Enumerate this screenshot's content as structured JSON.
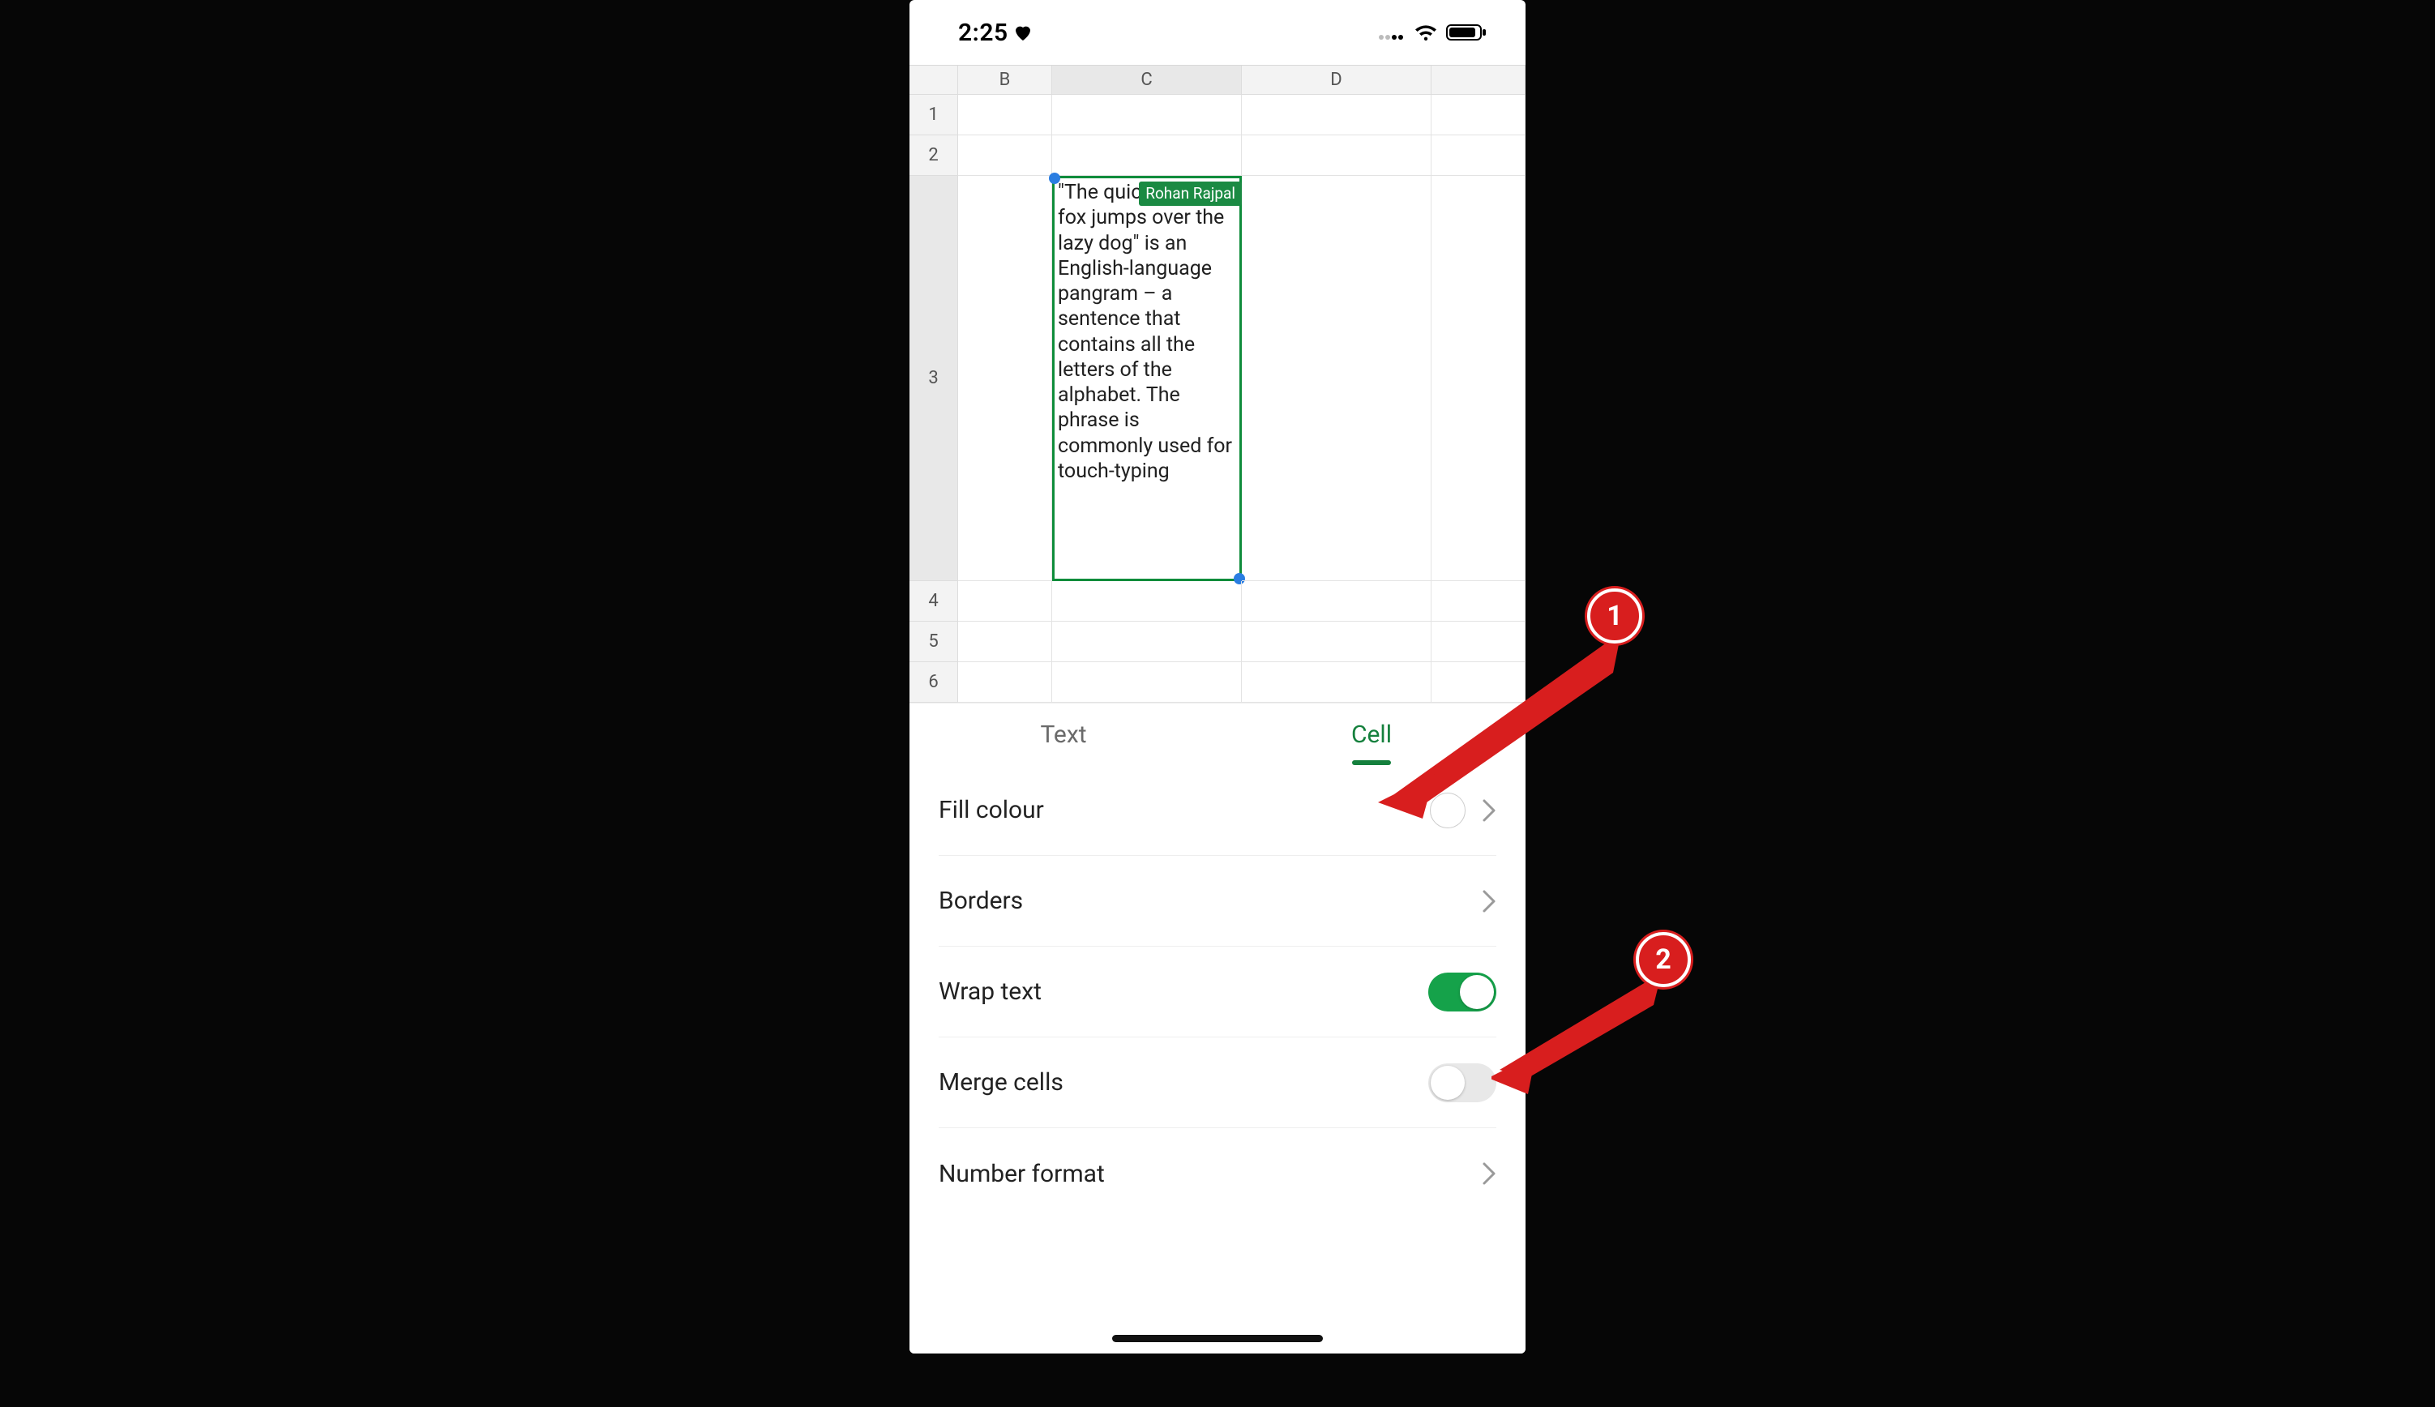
{
  "status_bar": {
    "time": "2:25",
    "icons": {
      "heart": "heart-icon",
      "cellular": "cellular-icon",
      "wifi": "wifi-icon",
      "battery": "battery-icon"
    }
  },
  "spreadsheet": {
    "column_headers": [
      "B",
      "C",
      "D"
    ],
    "row_headers": [
      "1",
      "2",
      "3",
      "4",
      "5",
      "6"
    ],
    "selected_cell": {
      "col": "C",
      "row": "3"
    },
    "selected_cell_text": "\"The quick brown fox jumps over the lazy dog\" is an English-language pangram – a sentence that contains all the letters of the alphabet. The phrase is commonly used for touch-typing",
    "collaborator_tag": "Rohan Rajpal"
  },
  "format_panel": {
    "tabs": {
      "text": "Text",
      "cell": "Cell",
      "active": "cell"
    },
    "options": {
      "fill_colour": {
        "label": "Fill colour",
        "swatch_color": "#ffffff"
      },
      "borders": {
        "label": "Borders"
      },
      "wrap_text": {
        "label": "Wrap text",
        "value": true
      },
      "merge_cells": {
        "label": "Merge cells",
        "value": false
      },
      "number_format": {
        "label": "Number format"
      }
    }
  },
  "annotations": {
    "callout_1": "1",
    "callout_2": "2"
  },
  "colors": {
    "sheets_green": "#15803d",
    "toggle_on": "#15a24a",
    "callout_red": "#d81e1e",
    "selection_green": "#0f8c3b"
  }
}
